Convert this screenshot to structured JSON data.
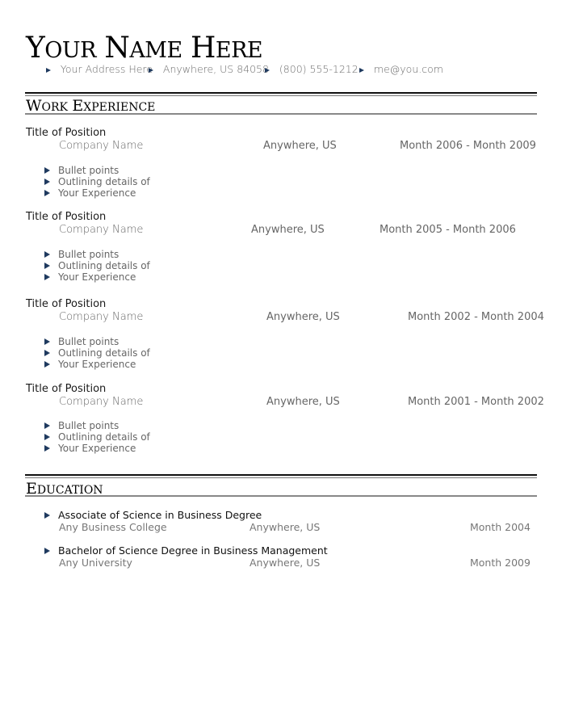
{
  "header": {
    "name_parts": [
      {
        "cap": "Y",
        "rest": "OUR"
      },
      {
        "cap": "N",
        "rest": "AME"
      },
      {
        "cap": "H",
        "rest": "ERE"
      }
    ],
    "contact": [
      "Your Address Here",
      "Anywhere, US 84058",
      "(800) 555-1212",
      "me@you.com"
    ]
  },
  "work": {
    "title_parts": [
      {
        "cap": "W",
        "rest": "ORK"
      },
      {
        "cap": "E",
        "rest": "XPERIENCE"
      }
    ],
    "jobs": [
      {
        "title": "Title of Position",
        "company": "Company Name",
        "location": "Anywhere, US",
        "dates": "Month 2006 - Month 2009",
        "bullets": [
          "Bullet points",
          "Outlining details of",
          "Your Experience"
        ]
      },
      {
        "title": "Title of Position",
        "company": "Company Name",
        "location": "Anywhere, US",
        "dates": "Month 2005 - Month 2006",
        "bullets": [
          "Bullet points",
          "Outlining details of",
          "Your Experience"
        ]
      },
      {
        "title": "Title of Position",
        "company": "Company Name",
        "location": "Anywhere, US",
        "dates": "Month 2002 - Month 2004",
        "bullets": [
          "Bullet points",
          "Outlining details of",
          "Your Experience"
        ]
      },
      {
        "title": "Title of Position",
        "company": "Company Name",
        "location": "Anywhere, US",
        "dates": "Month 2001 - Month 2002",
        "bullets": [
          "Bullet points",
          "Outlining details of",
          "Your Experience"
        ]
      }
    ]
  },
  "education": {
    "title_parts": [
      {
        "cap": "E",
        "rest": "DUCATION"
      }
    ],
    "entries": [
      {
        "degree": "Associate of Science in Business Degree",
        "school": "Any Business College",
        "location": "Anywhere, US",
        "date": "Month 2004"
      },
      {
        "degree": "Bachelor of Science Degree in Business Management",
        "school": "Any University",
        "location": "Anywhere, US",
        "date": "Month 2009"
      }
    ]
  },
  "colors": {
    "bullet": "#1f3a5f",
    "rule": "#111111"
  }
}
